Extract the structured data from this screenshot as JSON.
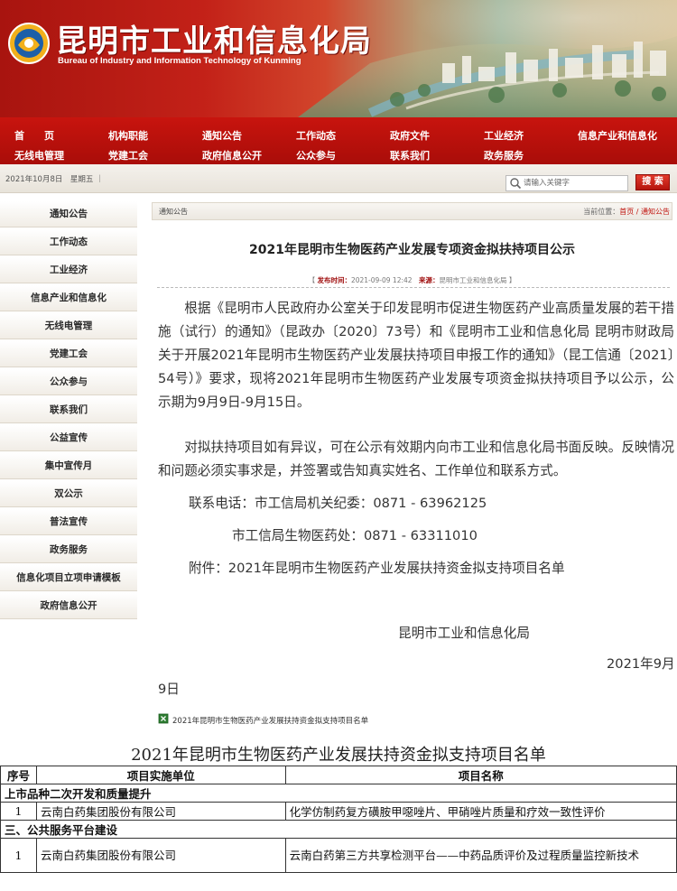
{
  "header": {
    "title": "昆明市工业和信息化局",
    "subtitle": "Bureau of Industry and Information Technology of Kunming"
  },
  "nav": {
    "row1": [
      "首　　页",
      "机构职能",
      "通知公告",
      "工作动态",
      "政府文件",
      "工业经济",
      "信息产业和信息化"
    ],
    "row2": [
      "无线电管理",
      "党建工会",
      "政府信息公开",
      "公众参与",
      "联系我们",
      "政务服务"
    ]
  },
  "subbar": {
    "date": "2021年10月8日　星期五 ｜",
    "search_placeholder": "请输入关键字",
    "search_button": "搜 索"
  },
  "sidebar": {
    "items": [
      "通知公告",
      "工作动态",
      "工业经济",
      "信息产业和信息化",
      "无线电管理",
      "党建工会",
      "公众参与",
      "联系我们",
      "公益宣传",
      "集中宣传月",
      "双公示",
      "普法宣传",
      "政务服务",
      "信息化项目立项申请模板",
      "政府信息公开"
    ]
  },
  "breadcrumb": {
    "section": "通知公告",
    "location_label": "当前位置：",
    "home": "首页",
    "separator": " / ",
    "current": "通知公告"
  },
  "article": {
    "title": "2021年昆明市生物医药产业发展专项资金拟扶持项目公示",
    "meta_open": "【 ",
    "meta_time_label": "发布时间：",
    "meta_time": "2021-09-09 12:42",
    "meta_source_label": "来源：",
    "meta_source": "昆明市工业和信息化局",
    "meta_close": " 】",
    "para1": "根据《昆明市人民政府办公室关于印发昆明市促进生物医药产业高质量发展的若干措施（试行）的通知》（昆政办〔2020〕73号）和《昆明市工业和信息化局 昆明市财政局关于开展2021年昆明市生物医药产业发展扶持项目申报工作的通知》（昆工信通〔2021〕54号）》要求，现将2021年昆明市生物医药产业发展专项资金拟扶持项目予以公示，公示期为9月9日-9月15日。",
    "para2": "对拟扶持项目如有异议，可在公示有效期内向市工业和信息化局书面反映。反映情况和问题必须实事求是，并签署或告知真实姓名、工作单位和联系方式。",
    "contact1": "联系电话：市工信局机关纪委：0871 - 63962125",
    "contact2": "市工信局生物医药处：0871 - 63311010",
    "attachment_line": "附件：2021年昆明市生物医药产业发展扶持资金拟支持项目名单",
    "signature": "昆明市工业和信息化局",
    "date_part1": "2021年9月",
    "date_part2": "9日",
    "attachment_link": "2021年昆明市生物医药产业发展扶持资金拟支持项目名单"
  },
  "document": {
    "title": "2021年昆明市生物医药产业发展扶持资金拟支持项目名单",
    "headers": [
      "序号",
      "项目实施单位",
      "项目名称"
    ],
    "section1": "上市品种二次开发和质量提升",
    "row1": [
      "1",
      "云南白药集团股份有限公司",
      "化学仿制药复方磺胺甲噁唑片、甲硝唑片质量和疗效一致性评价"
    ],
    "section2": "三、公共服务平台建设",
    "row2": [
      "1",
      "云南白药集团股份有限公司",
      "云南白药第三方共享检测平台——中药品质评价及过程质量监控新技术"
    ]
  }
}
